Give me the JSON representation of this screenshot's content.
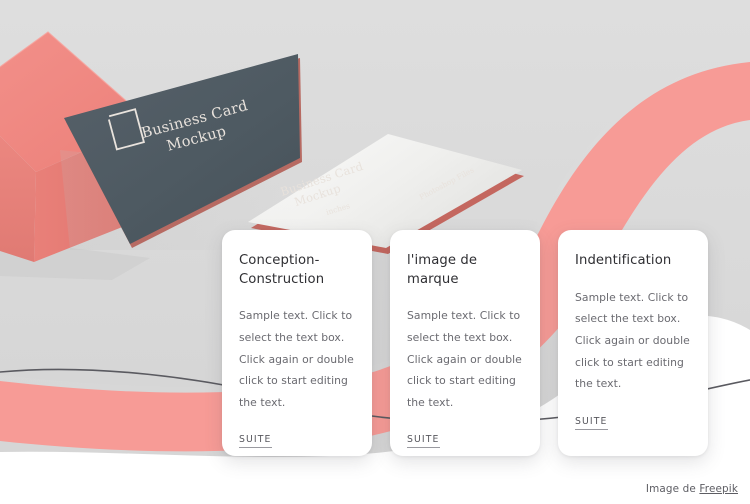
{
  "colors": {
    "background_grey": "#dcdcdc",
    "background_white": "#ffffff",
    "coral": "#ef8782",
    "coral_wave": "#f79b96",
    "card_dark": "#4f5b63",
    "card_white": "#f2f2f0",
    "line_grey": "#5a5a60",
    "title_text": "#2f2f33",
    "body_text": "#6a6a70",
    "link_text": "#57575d"
  },
  "hero": {
    "name": "business-card-mockup-photo",
    "dark_card": {
      "line1": "Business Card",
      "line2": "Mockup",
      "logo": "square-outline-logo"
    },
    "white_card": {
      "line1": "Business Card",
      "line2": "Mockup",
      "label_left": "inches",
      "label_right": "Photoshop Files"
    }
  },
  "cards": [
    {
      "id": "conception-construction",
      "title": "Conception-Construction",
      "body": "Sample text. Click to select the text box. Click again or double click to start editing the text.",
      "link_label": "SUITE"
    },
    {
      "id": "limage-de-marque",
      "title": "l'image de marque",
      "body": "Sample text. Click to select the text box. Click again or double click to start editing the text.",
      "link_label": "SUITE"
    },
    {
      "id": "indentification",
      "title": "Indentification",
      "body": "Sample text. Click to select the text box. Click again or double click to start editing the text.",
      "link_label": "SUITE"
    }
  ],
  "attribution": {
    "prefix": "Image de ",
    "link_label": "Freepik"
  }
}
